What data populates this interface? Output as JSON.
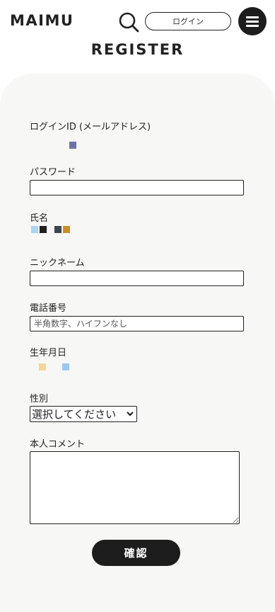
{
  "header": {
    "logo": "MAIMU",
    "login_label": "ログイン",
    "search_icon": "search-icon",
    "menu_icon": "hamburger-menu-icon"
  },
  "page": {
    "title": "REGISTER"
  },
  "form": {
    "login_id_label": "ログインID (メールアドレス)",
    "password_label": "パスワード",
    "name_label": "氏名",
    "nickname_label": "ニックネーム",
    "phone_label": "電話番号",
    "phone_placeholder": "半角数字、ハイフンなし",
    "birthdate_label": "生年月日",
    "gender_label": "性別",
    "gender_selected": "選択してください",
    "comment_label": "本人コメント",
    "confirm_label": "確認"
  },
  "colors": {
    "primary": "#1d1d1d",
    "panel_bg": "#f7f7f5",
    "swatch_login": "#6f74a6",
    "swatch_name": [
      "#a8d7f0",
      "#1f1f1f",
      "#3a4750",
      "#c98d2a"
    ],
    "swatch_birth": [
      "#f5d49b",
      "#9cc8ef"
    ]
  }
}
